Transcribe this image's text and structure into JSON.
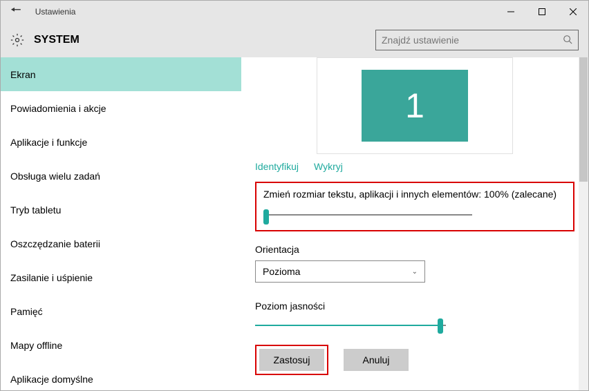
{
  "window": {
    "title": "Ustawienia"
  },
  "header": {
    "title": "SYSTEM"
  },
  "search": {
    "placeholder": "Znajdź ustawienie"
  },
  "sidebar": {
    "items": [
      {
        "label": "Ekran"
      },
      {
        "label": "Powiadomienia i akcje"
      },
      {
        "label": "Aplikacje i funkcje"
      },
      {
        "label": "Obsługa wielu zadań"
      },
      {
        "label": "Tryb tabletu"
      },
      {
        "label": "Oszczędzanie baterii"
      },
      {
        "label": "Zasilanie i uśpienie"
      },
      {
        "label": "Pamięć"
      },
      {
        "label": "Mapy offline"
      },
      {
        "label": "Aplikacje domyślne"
      }
    ],
    "active_index": 0
  },
  "main": {
    "monitor_number": "1",
    "identify_label": "Identyfikuj",
    "detect_label": "Wykryj",
    "scale_label": "Zmień rozmiar tekstu, aplikacji i innych elementów: 100% (zalecane)",
    "orientation_label": "Orientacja",
    "orientation_value": "Pozioma",
    "brightness_label": "Poziom jasności",
    "apply_label": "Zastosuj",
    "cancel_label": "Anuluj"
  }
}
